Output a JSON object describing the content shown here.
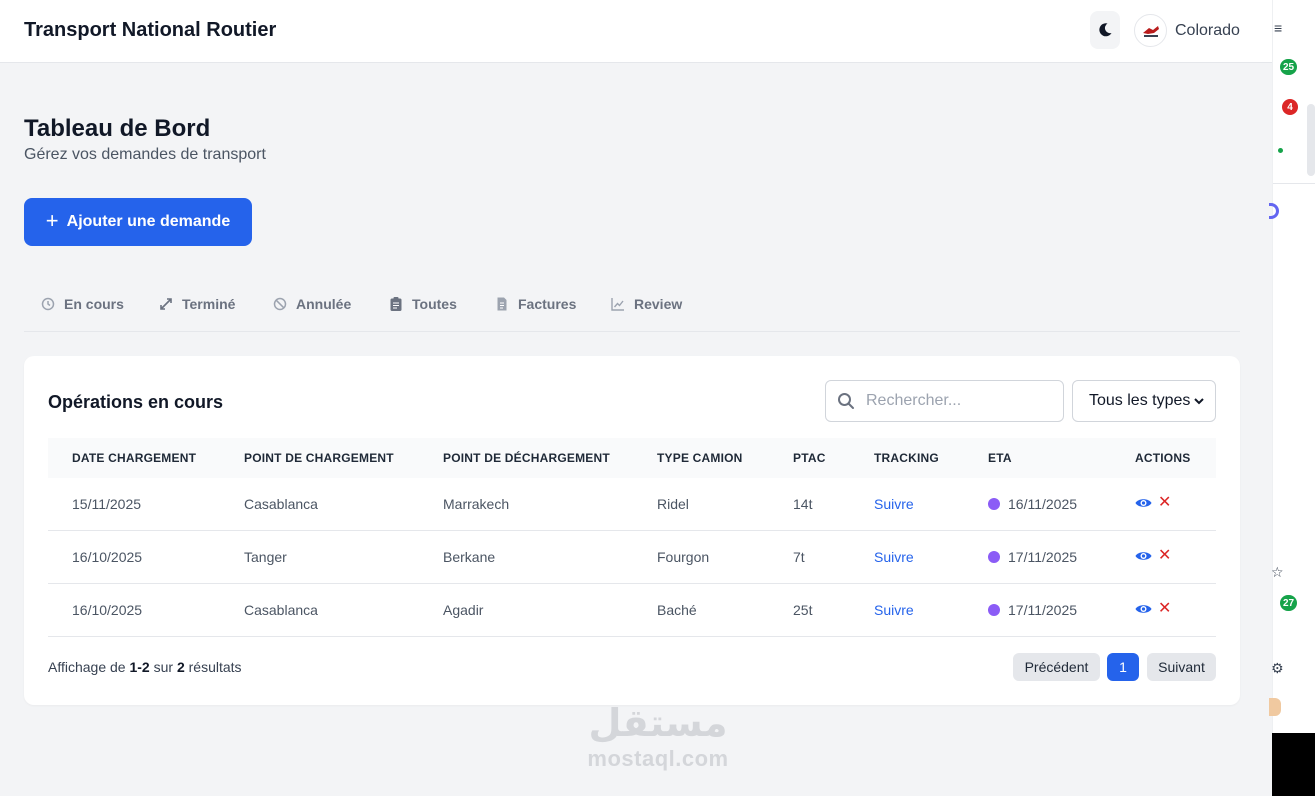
{
  "header": {
    "brand": "Transport National Routier",
    "theme_icon": "moon-icon",
    "user_name": "Colorado"
  },
  "page": {
    "title": "Tableau de Bord",
    "subtitle": "Gérez vos demandes de transport"
  },
  "add_button": {
    "label": "Ajouter une demande",
    "icon": "plus-icon"
  },
  "tabs": [
    {
      "label": "En cours",
      "icon": "history-icon"
    },
    {
      "label": "Terminé",
      "icon": "expand-icon"
    },
    {
      "label": "Annulée",
      "icon": "ban-icon"
    },
    {
      "label": "Toutes",
      "icon": "clipboard-icon"
    },
    {
      "label": "Factures",
      "icon": "invoice-icon"
    },
    {
      "label": "Review",
      "icon": "chart-line-icon"
    }
  ],
  "operations": {
    "title": "Opérations en cours",
    "search_placeholder": "Rechercher...",
    "type_filter": "Tous les types",
    "columns": [
      "DATE CHARGEMENT",
      "POINT DE CHARGEMENT",
      "POINT DE DÉCHARGEMENT",
      "TYPE CAMION",
      "PTAC",
      "TRACKING",
      "ETA",
      "ACTIONS"
    ],
    "rows": [
      {
        "date": "15/11/2025",
        "from": "Casablanca",
        "to": "Marrakech",
        "truck": "Ridel",
        "ptac": "14t",
        "tracking": "Suivre",
        "eta": "16/11/2025"
      },
      {
        "date": "16/10/2025",
        "from": "Tanger",
        "to": "Berkane",
        "truck": "Fourgon",
        "ptac": "7t",
        "tracking": "Suivre",
        "eta": "17/11/2025"
      },
      {
        "date": "16/10/2025",
        "from": "Casablanca",
        "to": "Agadir",
        "truck": "Baché",
        "ptac": "25t",
        "tracking": "Suivre",
        "eta": "17/11/2025"
      }
    ],
    "footer": {
      "prefix": "Affichage de",
      "range": "1-2",
      "middle": "sur",
      "total": "2",
      "suffix": "résultats"
    },
    "pagination": {
      "prev": "Précédent",
      "current": "1",
      "next": "Suivant"
    }
  },
  "watermark": {
    "arabic": "مستقل",
    "latin": "mostaql.com"
  },
  "side_badges": [
    "25",
    "4",
    "27"
  ],
  "colors": {
    "primary": "#2563eb",
    "eta_dot": "#8b5cf6",
    "delete": "#dc2626",
    "badge_green": "#16a34a",
    "badge_red": "#dc2626"
  }
}
